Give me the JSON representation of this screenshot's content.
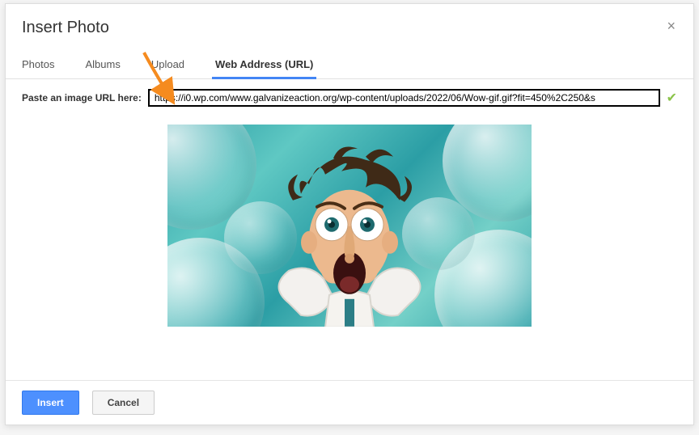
{
  "dialog": {
    "title": "Insert Photo"
  },
  "tabs": {
    "photos": "Photos",
    "albums": "Albums",
    "upload": "Upload",
    "url": "Web Address (URL)"
  },
  "url_section": {
    "label": "Paste an image URL here:",
    "value": "https://i0.wp.com/www.galvanizeaction.org/wp-content/uploads/2022/06/Wow-gif.gif?fit=450%2C250&s"
  },
  "footer": {
    "insert": "Insert",
    "cancel": "Cancel"
  },
  "colors": {
    "primary": "#4d90fe",
    "tab_active": "#4285f4",
    "arrow": "#f58b1f"
  }
}
